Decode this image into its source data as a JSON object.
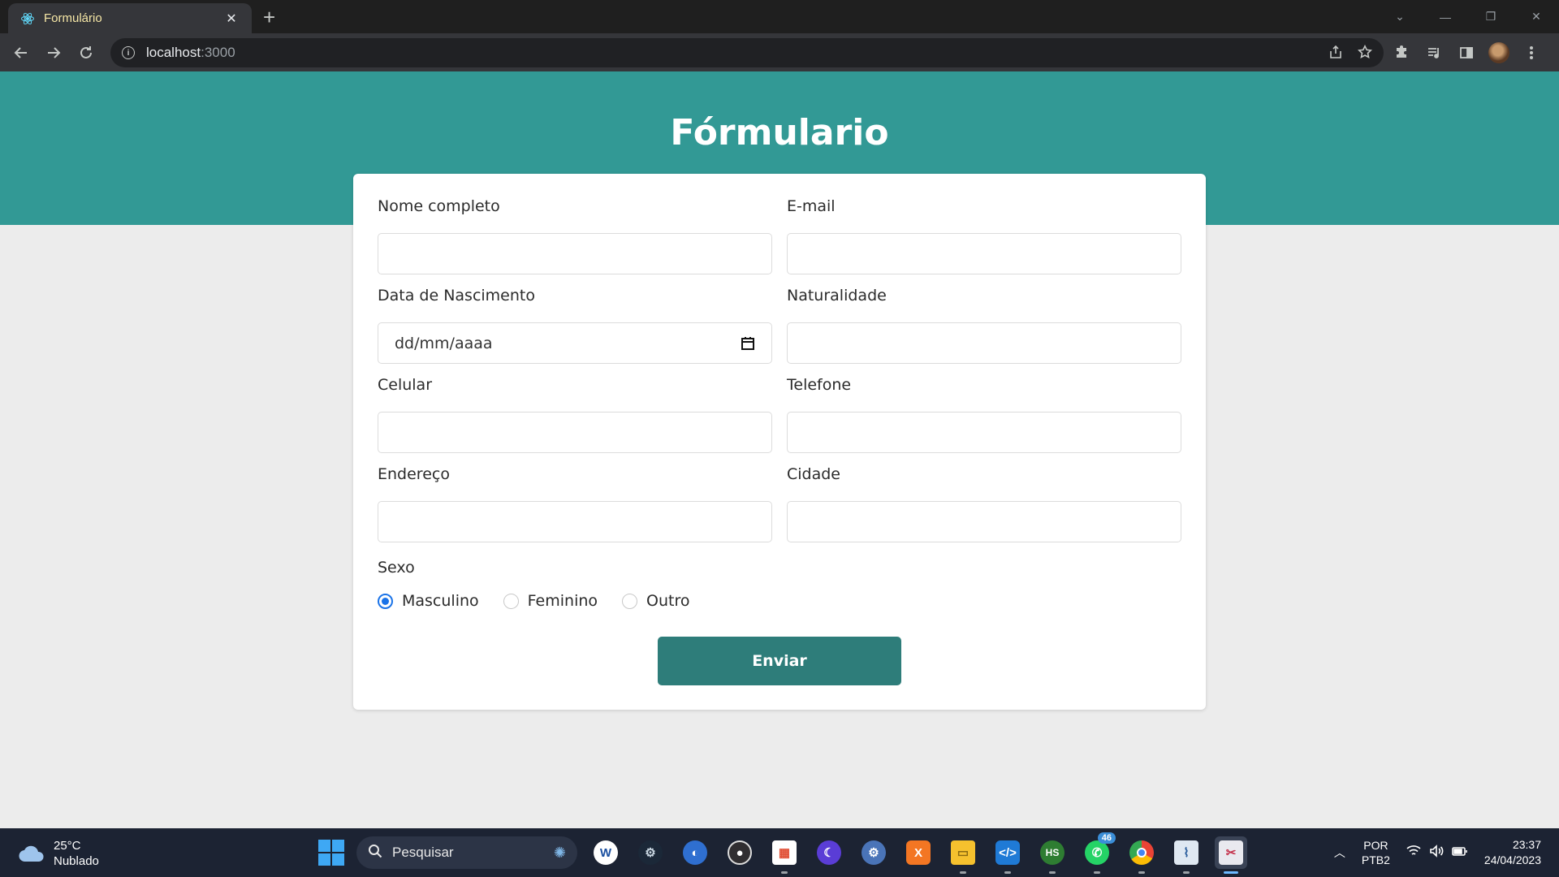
{
  "browser": {
    "tab_title": "Formulário",
    "url_host": "localhost",
    "url_port": ":3000"
  },
  "page": {
    "title": "Fórmulario",
    "fields": [
      {
        "label": "Nome completo",
        "value": ""
      },
      {
        "label": "E-mail",
        "value": ""
      },
      {
        "label": "Data de Nascimento",
        "placeholder": "dd/mm/aaaa"
      },
      {
        "label": "Naturalidade",
        "value": ""
      },
      {
        "label": "Celular",
        "value": ""
      },
      {
        "label": "Telefone",
        "value": ""
      },
      {
        "label": "Endereço",
        "value": ""
      },
      {
        "label": "Cidade",
        "value": ""
      }
    ],
    "sexo": {
      "label": "Sexo",
      "options": [
        "Masculino",
        "Feminino",
        "Outro"
      ],
      "selected": "Masculino"
    },
    "submit_label": "Enviar",
    "colors": {
      "header": "#329995",
      "button": "#2e7d7a",
      "radio": "#1a73e8"
    }
  },
  "taskbar": {
    "weather_temp": "25°C",
    "weather_desc": "Nublado",
    "search_label": "Pesquisar",
    "whatsapp_badge": "46",
    "lang_top": "POR",
    "lang_bottom": "PTB2",
    "time": "23:37",
    "date": "24/04/2023"
  }
}
